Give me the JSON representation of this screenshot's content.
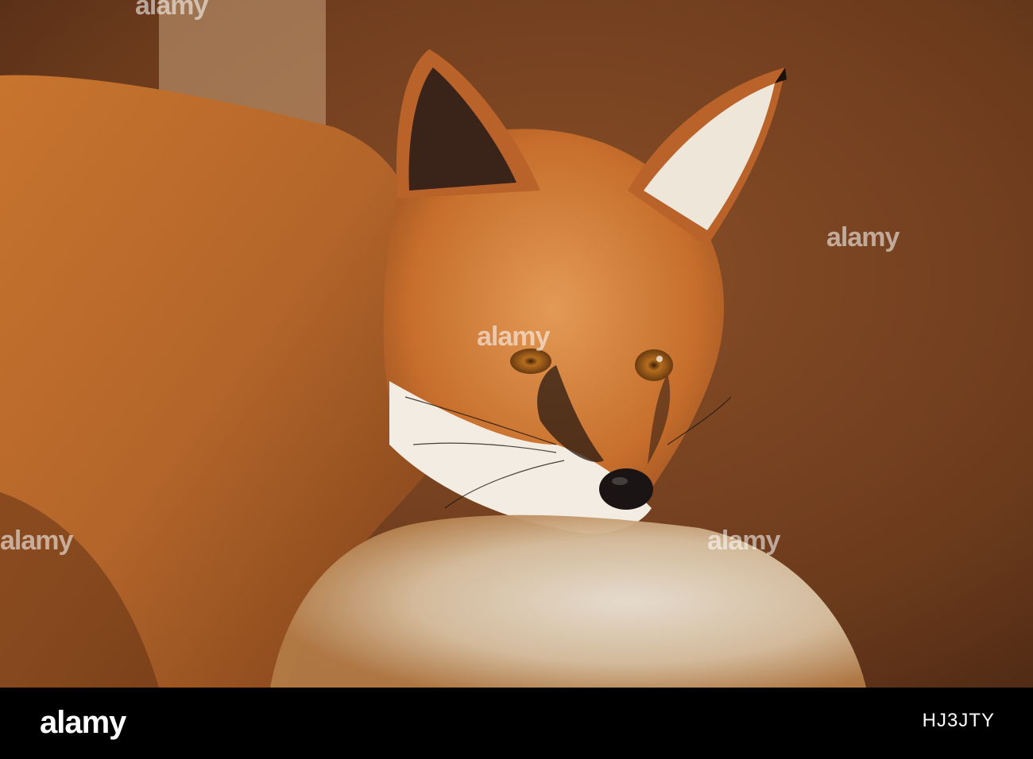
{
  "photo": {
    "subject": "red fox",
    "colors": {
      "background": "#6b3a1c",
      "fur": "#c46a2a",
      "fur_light": "#e9c9a0",
      "white_fur": "#f3ece2",
      "dark_marking": "#2a1a12",
      "eye": "#a86418",
      "nose": "#1a1414"
    }
  },
  "watermarks": {
    "text": "alamy"
  },
  "footer": {
    "brand": "alamy",
    "image_id": "HJ3JTY",
    "background": "#000000"
  }
}
